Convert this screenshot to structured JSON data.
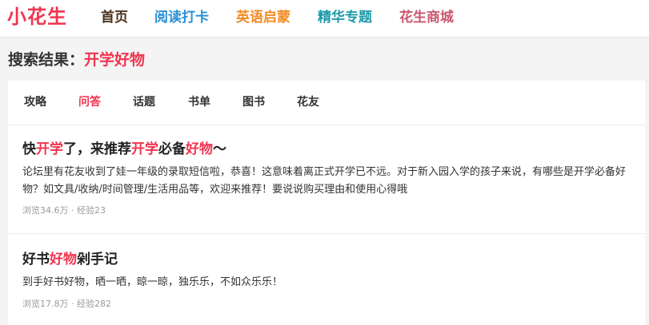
{
  "brand": {
    "logo": "小花生",
    "color": "#f0344f"
  },
  "nav": [
    {
      "label": "首页",
      "color": "#4a3320"
    },
    {
      "label": "阅读打卡",
      "color": "#2a8fd4"
    },
    {
      "label": "英语启蒙",
      "color": "#f08a24"
    },
    {
      "label": "精华专题",
      "color": "#1f9aa8"
    },
    {
      "label": "花生商城",
      "color": "#c9566d"
    }
  ],
  "search": {
    "label": "搜索结果：",
    "keyword": "开学好物"
  },
  "tabs": [
    {
      "label": "攻略",
      "active": false
    },
    {
      "label": "问答",
      "active": true
    },
    {
      "label": "话题",
      "active": false
    },
    {
      "label": "书单",
      "active": false
    },
    {
      "label": "图书",
      "active": false
    },
    {
      "label": "花友",
      "active": false
    }
  ],
  "results": [
    {
      "title_parts": [
        {
          "text": "快",
          "hl": false
        },
        {
          "text": "开学",
          "hl": true
        },
        {
          "text": "了，来推荐",
          "hl": false
        },
        {
          "text": "开学",
          "hl": true
        },
        {
          "text": "必备",
          "hl": false
        },
        {
          "text": "好物",
          "hl": true
        },
        {
          "text": "～",
          "hl": false
        }
      ],
      "desc": "论坛里有花友收到了娃一年级的录取短信啦，恭喜！这意味着离正式开学已不远。对于新入园入学的孩子来说，有哪些是开学必备好物？如文具/收纳/时间管理/生活用品等，欢迎来推荐！要说说购买理由和使用心得哦",
      "meta": "浏览34.6万 · 经验23"
    },
    {
      "title_parts": [
        {
          "text": "好书",
          "hl": false
        },
        {
          "text": "好物",
          "hl": true
        },
        {
          "text": "剁手记",
          "hl": false
        }
      ],
      "desc": "到手好书好物，晒一晒，晾一晾，独乐乐，不如众乐乐！",
      "meta": "浏览17.8万 · 经验282"
    }
  ]
}
